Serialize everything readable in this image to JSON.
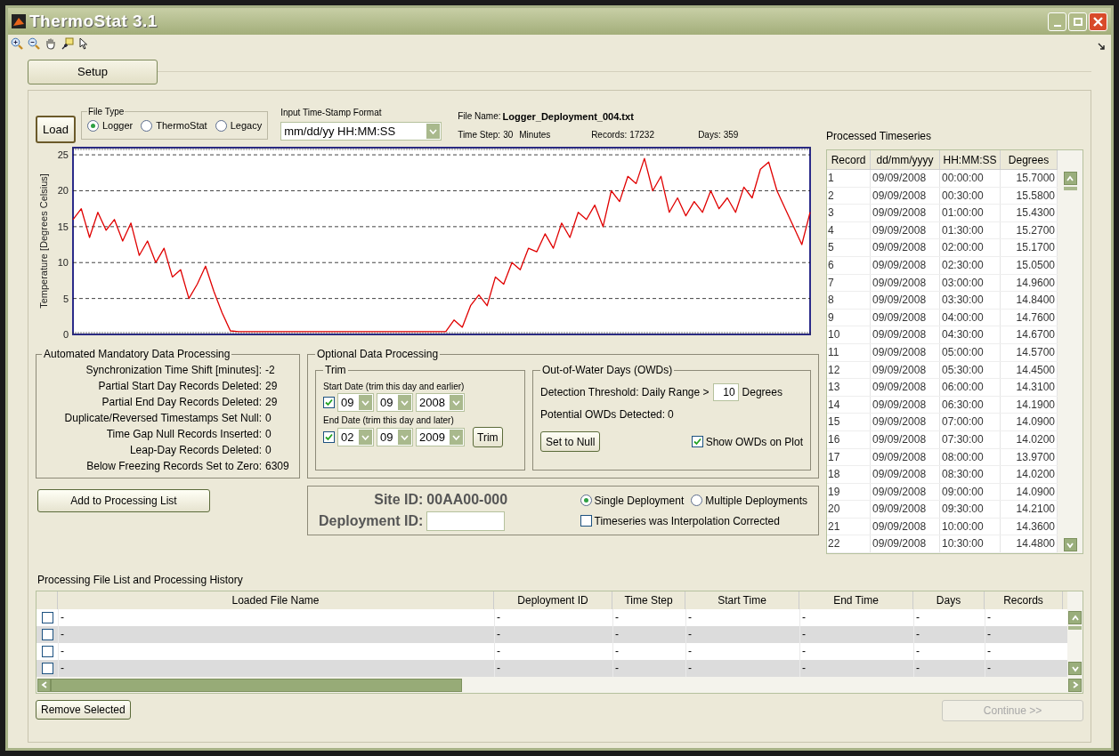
{
  "window": {
    "title": "ThermoStat 3.1"
  },
  "setup_tab": {
    "label": "Setup",
    "selected": true
  },
  "load_button": {
    "label": "Load"
  },
  "file_type": {
    "legend": "File Type",
    "options": [
      {
        "label": "Logger",
        "selected": true
      },
      {
        "label": "ThermoStat",
        "selected": false
      },
      {
        "label": "Legacy",
        "selected": false
      }
    ]
  },
  "timestamp_format": {
    "label": "Input Time-Stamp Format",
    "value": "mm/dd/yy HH:MM:SS"
  },
  "file_info": {
    "file_name_label": "File Name:",
    "file_name": "Logger_Deployment_004.txt",
    "time_step_label": "Time Step:",
    "time_step": "30",
    "time_step_unit": "Minutes",
    "records_label": "Records:",
    "records": "17232",
    "days_label": "Days:",
    "days": "359"
  },
  "chart": {
    "chart_data": {
      "type": "line",
      "ylabel": "Temperature [Degrees Celsius]",
      "ylim": [
        0,
        26
      ],
      "yticks": [
        0,
        5,
        10,
        15,
        20,
        25
      ],
      "grid": true,
      "series": [
        {
          "color": "#e00000",
          "values": [
            16,
            17.5,
            13.5,
            17,
            14.5,
            16,
            13,
            15.5,
            11,
            13,
            10,
            12,
            8,
            9,
            5,
            7,
            9.5,
            6,
            3,
            0.5,
            0.4,
            0.4,
            0.4,
            0.4,
            0.4,
            0.4,
            0.4,
            0.4,
            0.4,
            0.4,
            0.4,
            0.4,
            0.4,
            0.4,
            0.4,
            0.4,
            0.4,
            0.4,
            0.4,
            0.4,
            0.4,
            0.4,
            0.4,
            0.4,
            0.4,
            0.4,
            2,
            1,
            4,
            5.5,
            4,
            8,
            7,
            10,
            9,
            12,
            11.5,
            14,
            12,
            15.5,
            13.5,
            17,
            16,
            18,
            15,
            20,
            18.5,
            22,
            21,
            24.5,
            20,
            22,
            17,
            19,
            16.5,
            18.5,
            17,
            20,
            17.5,
            19,
            17,
            20.5,
            19,
            23,
            24,
            20,
            17.5,
            15,
            12.5,
            17
          ]
        }
      ]
    }
  },
  "automated": {
    "legend": "Automated Mandatory Data Processing",
    "rows": [
      {
        "label": "Synchronization Time Shift [minutes]:",
        "value": "-2"
      },
      {
        "label": "Partial Start Day Records Deleted:",
        "value": "29"
      },
      {
        "label": "Partial End Day Records Deleted:",
        "value": "29"
      },
      {
        "label": "Duplicate/Reversed Timestamps Set Null:",
        "value": "0"
      },
      {
        "label": "Time Gap Null Records Inserted:",
        "value": "0"
      },
      {
        "label": "Leap-Day Records Deleted:",
        "value": "0"
      },
      {
        "label": "Below Freezing Records Set to Zero:",
        "value": "6309"
      }
    ]
  },
  "optional": {
    "legend": "Optional Data Processing",
    "trim": {
      "legend": "Trim",
      "dates": [
        {
          "label": "Start Date (trim this day and earlier)",
          "checked": true,
          "month": "09",
          "day": "09",
          "year": "2008"
        },
        {
          "label": "End Date (trim this day and later)",
          "checked": true,
          "month": "02",
          "day": "09",
          "year": "2009"
        }
      ],
      "button": "Trim"
    },
    "owd": {
      "legend": "Out-of-Water Days (OWDs)",
      "threshold_label": "Detection Threshold:  Daily Range >",
      "threshold_value": "10",
      "threshold_unit": "Degrees",
      "detected_label": "Potential OWDs Detected:",
      "detected_value": "0",
      "button": "Set to Null",
      "show_checkbox": {
        "label": "Show OWDs on Plot",
        "checked": true
      }
    }
  },
  "add_button": {
    "label": "Add to Processing List"
  },
  "deployment": {
    "site_label": "Site ID:",
    "site_id": "00AA00-000",
    "deployment_label": "Deployment ID:",
    "options": [
      {
        "label": "Single Deployment",
        "selected": true
      },
      {
        "label": "Multiple Deployments",
        "selected": false
      }
    ],
    "interpolation": {
      "label": "Timeseries was Interpolation Corrected",
      "checked": false
    }
  },
  "timeseries": {
    "title": "Processed Timeseries",
    "columns": [
      "Record",
      "dd/mm/yyyy",
      "HH:MM:SS",
      "Degrees"
    ],
    "rows": [
      [
        "1",
        "09/09/2008",
        "00:00:00",
        "15.7000"
      ],
      [
        "2",
        "09/09/2008",
        "00:30:00",
        "15.5800"
      ],
      [
        "3",
        "09/09/2008",
        "01:00:00",
        "15.4300"
      ],
      [
        "4",
        "09/09/2008",
        "01:30:00",
        "15.2700"
      ],
      [
        "5",
        "09/09/2008",
        "02:00:00",
        "15.1700"
      ],
      [
        "6",
        "09/09/2008",
        "02:30:00",
        "15.0500"
      ],
      [
        "7",
        "09/09/2008",
        "03:00:00",
        "14.9600"
      ],
      [
        "8",
        "09/09/2008",
        "03:30:00",
        "14.8400"
      ],
      [
        "9",
        "09/09/2008",
        "04:00:00",
        "14.7600"
      ],
      [
        "10",
        "09/09/2008",
        "04:30:00",
        "14.6700"
      ],
      [
        "11",
        "09/09/2008",
        "05:00:00",
        "14.5700"
      ],
      [
        "12",
        "09/09/2008",
        "05:30:00",
        "14.4500"
      ],
      [
        "13",
        "09/09/2008",
        "06:00:00",
        "14.3100"
      ],
      [
        "14",
        "09/09/2008",
        "06:30:00",
        "14.1900"
      ],
      [
        "15",
        "09/09/2008",
        "07:00:00",
        "14.0900"
      ],
      [
        "16",
        "09/09/2008",
        "07:30:00",
        "14.0200"
      ],
      [
        "17",
        "09/09/2008",
        "08:00:00",
        "13.9700"
      ],
      [
        "18",
        "09/09/2008",
        "08:30:00",
        "14.0200"
      ],
      [
        "19",
        "09/09/2008",
        "09:00:00",
        "14.0900"
      ],
      [
        "20",
        "09/09/2008",
        "09:30:00",
        "14.2100"
      ],
      [
        "21",
        "09/09/2008",
        "10:00:00",
        "14.3600"
      ],
      [
        "22",
        "09/09/2008",
        "10:30:00",
        "14.4800"
      ]
    ]
  },
  "file_list": {
    "title": "Processing File List and Processing History",
    "columns": [
      "Loaded File Name",
      "Deployment ID",
      "Time Step",
      "Start Time",
      "End Time",
      "Days",
      "Records"
    ],
    "rows": [
      {
        "checked": false,
        "cells": [
          "-",
          "-",
          "-",
          "-",
          "-",
          "-",
          "-"
        ]
      },
      {
        "checked": false,
        "cells": [
          "-",
          "-",
          "-",
          "-",
          "-",
          "-",
          "-"
        ]
      },
      {
        "checked": false,
        "cells": [
          "-",
          "-",
          "-",
          "-",
          "-",
          "-",
          "-"
        ]
      },
      {
        "checked": false,
        "cells": [
          "-",
          "-",
          "-",
          "-",
          "-",
          "-",
          "-"
        ]
      }
    ]
  },
  "remove_button": {
    "label": "Remove Selected"
  },
  "continue_button": {
    "label": "Continue >>",
    "disabled": true
  }
}
